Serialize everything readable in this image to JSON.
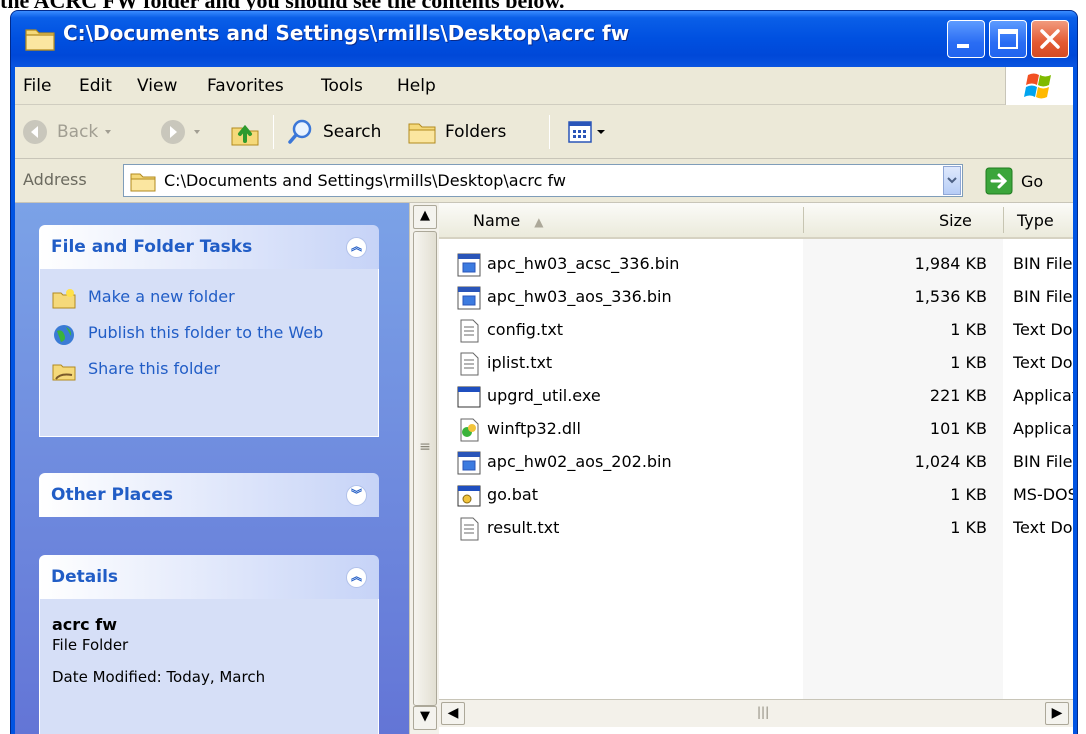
{
  "caption": "the ACRC FW folder and you should see the contents below.",
  "window": {
    "title": "C:\\Documents and Settings\\rmills\\Desktop\\acrc fw"
  },
  "menu": [
    {
      "label": "File"
    },
    {
      "label": "Edit"
    },
    {
      "label": "View"
    },
    {
      "label": "Favorites"
    },
    {
      "label": "Tools"
    },
    {
      "label": "Help"
    }
  ],
  "toolbar": {
    "back": "Back",
    "search": "Search",
    "folders": "Folders"
  },
  "address": {
    "label": "Address",
    "value": "C:\\Documents and Settings\\rmills\\Desktop\\acrc fw",
    "go": "Go"
  },
  "tasks_panel": {
    "title": "File and Folder Tasks",
    "items": [
      {
        "label": "Make a new folder"
      },
      {
        "label": "Publish this folder to the Web"
      },
      {
        "label": "Share this folder"
      }
    ]
  },
  "other_places": {
    "title": "Other Places"
  },
  "details": {
    "title": "Details",
    "name": "acrc fw",
    "type": "File Folder",
    "date": "Date Modified: Today, March"
  },
  "columns": {
    "name": "Name",
    "size": "Size",
    "type": "Type"
  },
  "files": [
    {
      "name": "apc_hw03_acsc_336.bin",
      "size": "1,984 KB",
      "type": "BIN File",
      "icon": "bin-file-icon"
    },
    {
      "name": "apc_hw03_aos_336.bin",
      "size": "1,536 KB",
      "type": "BIN File",
      "icon": "bin-file-icon"
    },
    {
      "name": "config.txt",
      "size": "1 KB",
      "type": "Text Document",
      "icon": "text-file-icon"
    },
    {
      "name": "iplist.txt",
      "size": "1 KB",
      "type": "Text Document",
      "icon": "text-file-icon"
    },
    {
      "name": "upgrd_util.exe",
      "size": "221 KB",
      "type": "Application",
      "icon": "exe-file-icon"
    },
    {
      "name": "winftp32.dll",
      "size": "101 KB",
      "type": "Application Extension",
      "icon": "dll-file-icon"
    },
    {
      "name": "apc_hw02_aos_202.bin",
      "size": "1,024 KB",
      "type": "BIN File",
      "icon": "bin-file-icon"
    },
    {
      "name": "go.bat",
      "size": "1 KB",
      "type": "MS-DOS Batch File",
      "icon": "bat-file-icon"
    },
    {
      "name": "result.txt",
      "size": "1 KB",
      "type": "Text Document",
      "icon": "text-file-icon"
    }
  ],
  "colors": {
    "titlebar": "#0054e3",
    "chrome": "#ece9d8",
    "task_link": "#215dc6",
    "left_pane": "#7ba2e7"
  }
}
